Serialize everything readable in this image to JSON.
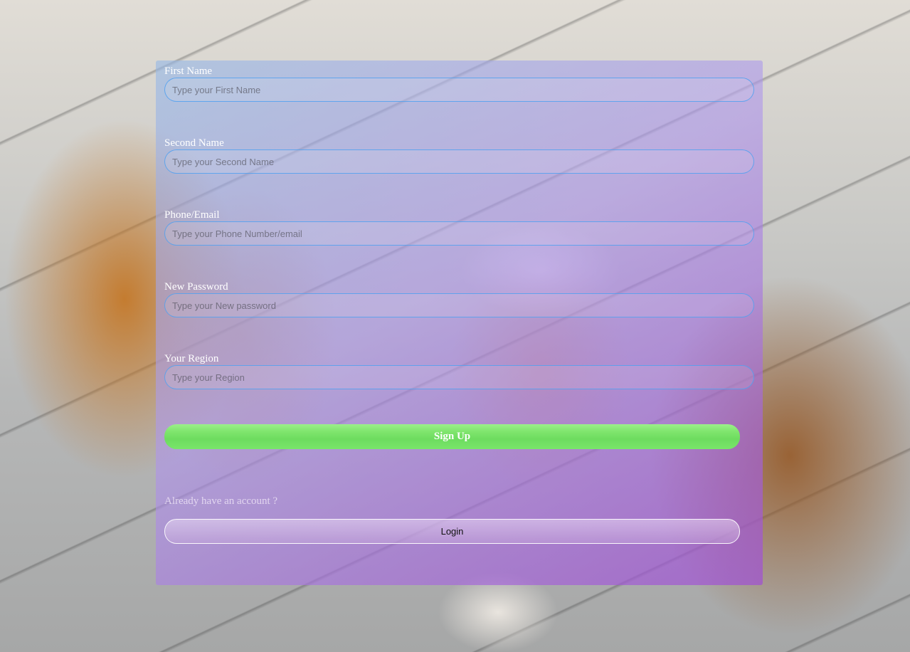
{
  "form": {
    "fields": [
      {
        "label": "First Name",
        "placeholder": "Type your First Name",
        "value": ""
      },
      {
        "label": "Second Name",
        "placeholder": "Type your Second Name",
        "value": ""
      },
      {
        "label": "Phone/Email",
        "placeholder": "Type your Phone Number/email",
        "value": ""
      },
      {
        "label": "New Password",
        "placeholder": "Type your New password",
        "value": ""
      },
      {
        "label": "Your Region",
        "placeholder": "Type your Region",
        "value": ""
      }
    ],
    "signup_label": "Sign Up",
    "already_text": "Already have an account ?",
    "login_label": "Login"
  },
  "colors": {
    "signup_button": "#6ddc5f",
    "input_border": "#50a0f0",
    "panel_tint": "#a050d2"
  }
}
